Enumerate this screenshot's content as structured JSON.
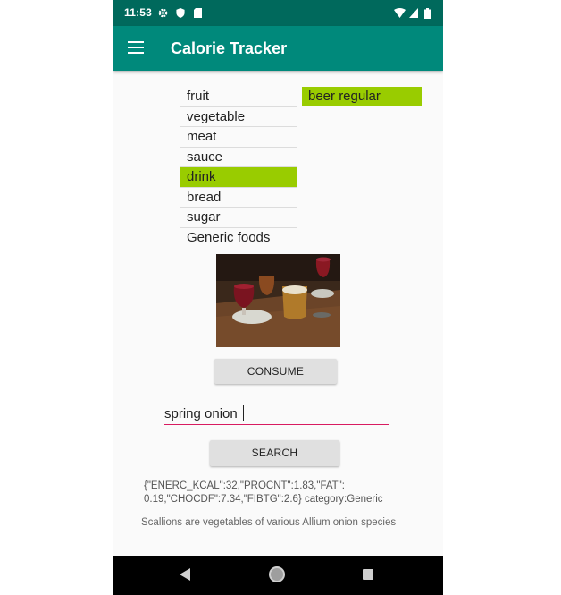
{
  "status_bar": {
    "time": "11:53",
    "icons": [
      "settings-icon",
      "shield-icon",
      "sd-card-icon",
      "wifi-icon",
      "signal-icon",
      "battery-icon"
    ]
  },
  "app_bar": {
    "title": "Calorie Tracker",
    "menu_icon": "hamburger-menu-icon"
  },
  "categories": [
    "fruit",
    "vegetable",
    "meat",
    "sauce",
    "drink",
    "bread",
    "sugar",
    "Generic foods"
  ],
  "selected_category": "drink",
  "foods": [
    "beer regular"
  ],
  "selected_food": "beer regular",
  "buttons": {
    "consume": "CONSUME",
    "search": "SEARCH"
  },
  "search": {
    "value": "spring onion"
  },
  "result": {
    "nutrients": "{\"ENERC_KCAL\":32,\"PROCNT\":1.83,\"FAT\": 0.19,\"CHOCDF\":7.34,\"FIBTG\":2.6} category:Generic",
    "description": "Scallions are vegetables of various Allium onion species"
  },
  "colors": {
    "status_bar": "#00695c",
    "app_bar": "#00897b",
    "selection": "#99cc00",
    "input_underline": "#d81b60"
  },
  "nav_bar": {
    "icons": [
      "back-icon",
      "home-icon",
      "recents-icon"
    ]
  }
}
